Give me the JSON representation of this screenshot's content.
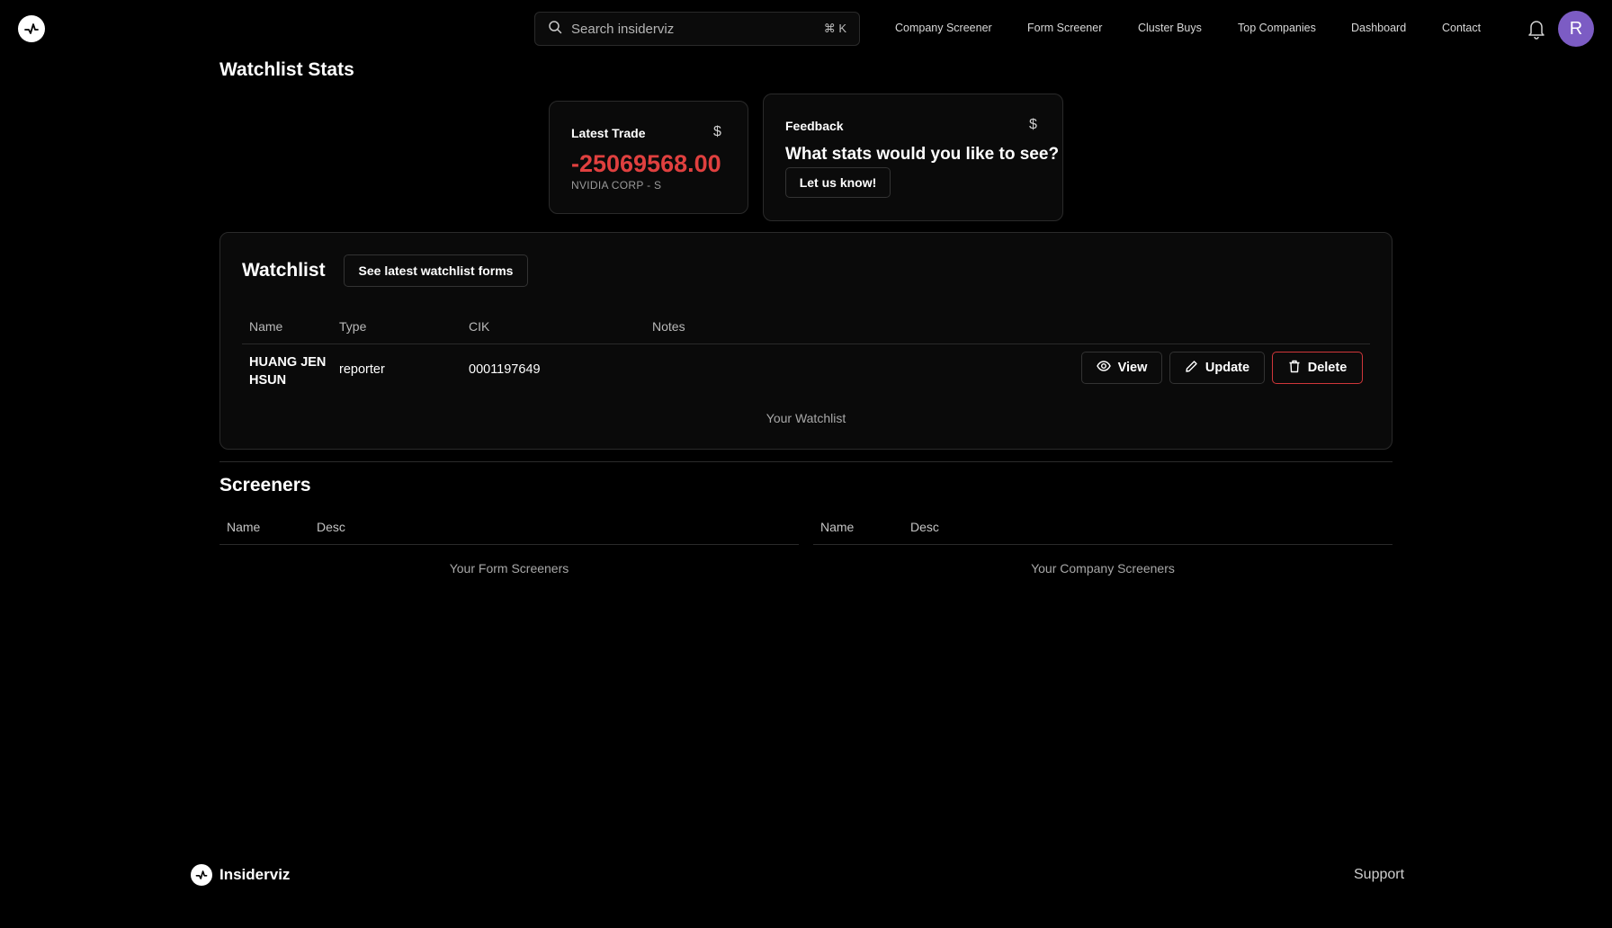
{
  "header": {
    "search_placeholder": "Search insiderviz",
    "search_shortcut": "⌘ K",
    "nav": [
      "Company Screener",
      "Form Screener",
      "Cluster Buys",
      "Top Companies",
      "Dashboard",
      "Contact"
    ],
    "avatar_letter": "R",
    "avatar_color": "#7c5cc4"
  },
  "stats": {
    "title": "Watchlist Stats",
    "latest_trade": {
      "label": "Latest Trade",
      "icon": "$",
      "value": "-25069568.00",
      "company": "NVIDIA CORP - S",
      "value_color": "#e0403f"
    },
    "feedback": {
      "label": "Feedback",
      "icon": "$",
      "question": "What stats would you like to see?",
      "button": "Let us know!"
    }
  },
  "watchlist": {
    "title": "Watchlist",
    "latest_forms_button": "See latest watchlist forms",
    "columns": [
      "Name",
      "Type",
      "CIK",
      "Notes"
    ],
    "rows": [
      {
        "name_line1": "HUANG JEN",
        "name_line2": "HSUN",
        "type": "reporter",
        "cik": "0001197649",
        "notes": ""
      }
    ],
    "actions": {
      "view": "View",
      "update": "Update",
      "delete": "Delete"
    },
    "caption": "Your Watchlist"
  },
  "screeners": {
    "title": "Screeners",
    "form": {
      "columns": [
        "Name",
        "Desc"
      ],
      "caption": "Your Form Screeners"
    },
    "company": {
      "columns": [
        "Name",
        "Desc"
      ],
      "caption": "Your Company Screeners"
    }
  },
  "footer": {
    "brand": "Insiderviz",
    "support": "Support"
  }
}
